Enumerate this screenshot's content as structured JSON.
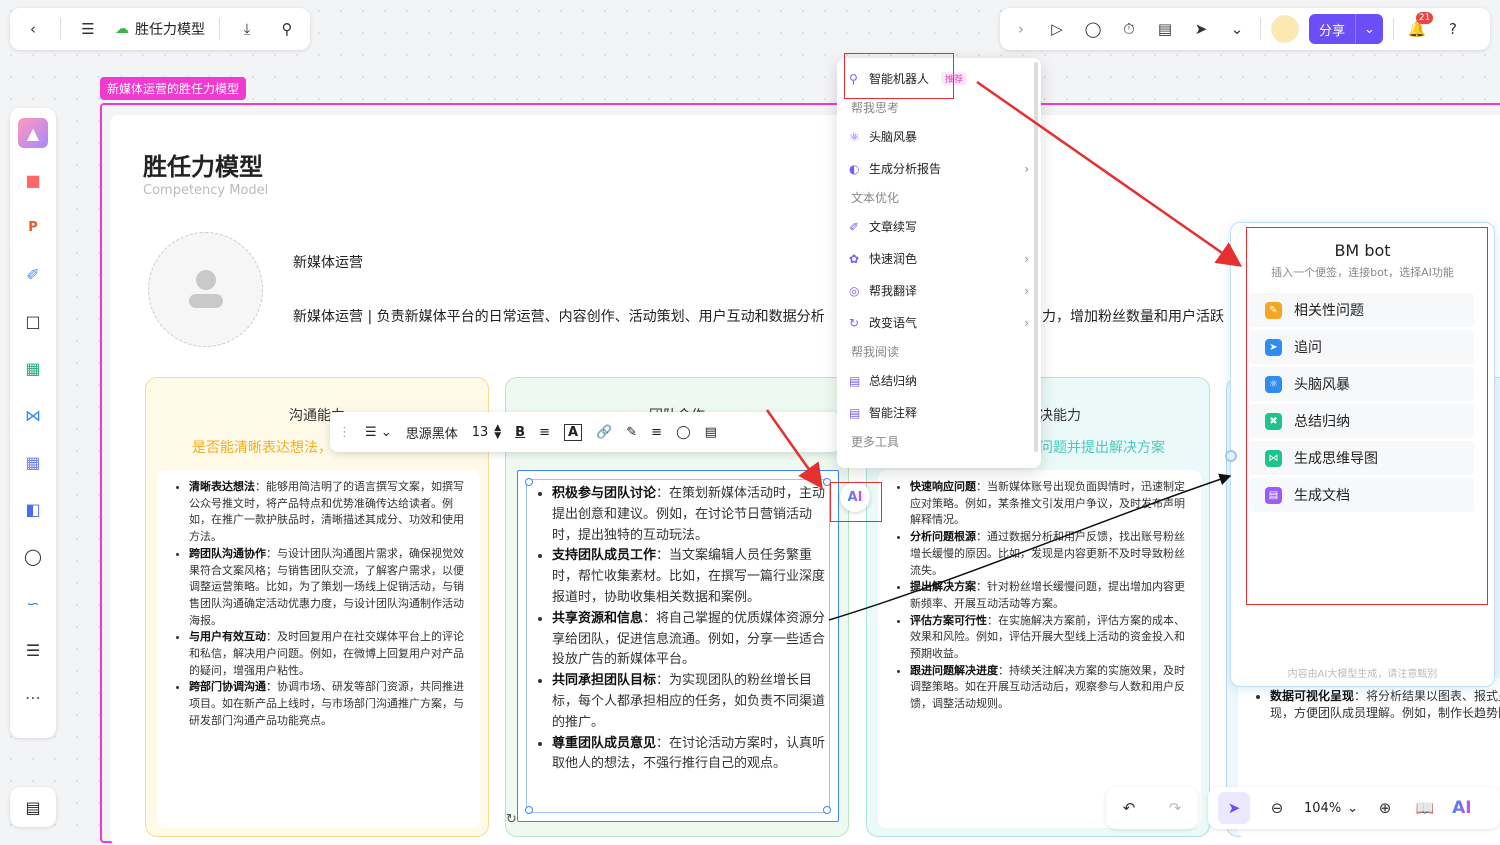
{
  "topbar": {
    "back_icon": "chevron-left-icon",
    "menu_icon": "hamburger-icon",
    "doc_title": "胜任力模型",
    "share_label": "分享",
    "notification_count": "21"
  },
  "frame": {
    "tag": "新媒体运营的胜任力模型",
    "title": "胜任力模型",
    "subtitle": "Competency Model",
    "role": "新媒体运营",
    "description_left": "新媒体运营 | 负责新媒体平台的日常运营、内容创作、活动策划、用户互动和数据分析",
    "description_right": "力，增加粉丝数量和用户活跃"
  },
  "columns": {
    "comm": {
      "heading": "沟通能力",
      "subheading": "是否能清晰表达想法，",
      "items": [
        {
          "bold": "清晰表达想法",
          "text": "：能够用简洁明了的语言撰写文案，如撰写公众号推文时，将产品特点和优势准确传达给读者。例如，在推广一款护肤品时，清晰描述其成分、功效和使用方法。"
        },
        {
          "bold": "跨团队沟通协作",
          "text": "：与设计团队沟通图片需求，确保视觉效果符合文案风格；与销售团队交流，了解客户需求，以便调整运营策略。比如，为了策划一场线上促销活动，与销售团队沟通确定活动优惠力度，与设计团队沟通制作活动海报。"
        },
        {
          "bold": "与用户有效互动",
          "text": "：及时回复用户在社交媒体平台上的评论和私信，解决用户问题。例如，在微博上回复用户对产品的疑问，增强用户粘性。"
        },
        {
          "bold": "跨部门协调沟通",
          "text": "：协调市场、研发等部门资源，共同推进项目。如在新产品上线时，与市场部门沟通推广方案，与研发部门沟通产品功能亮点。"
        }
      ]
    },
    "team": {
      "heading": "团队合作",
      "items": [
        {
          "bold": "积极参与团队讨论",
          "text": "：在策划新媒体活动时，主动提出创意和建议。例如，在讨论节日营销活动时，提出独特的互动玩法。"
        },
        {
          "bold": "支持团队成员工作",
          "text": "：当文案编辑人员任务繁重时，帮忙收集素材。比如，在撰写一篇行业深度报道时，协助收集相关数据和案例。"
        },
        {
          "bold": "共享资源和信息",
          "text": "：将自己掌握的优质媒体资源分享给团队，促进信息流通。例如，分享一些适合投放广告的新媒体平台。"
        },
        {
          "bold": "共同承担团队目标",
          "text": "：为实现团队的粉丝增长目标，每个人都承担相应的任务，如负责不同渠道的推广。"
        },
        {
          "bold": "尊重团队成员意见",
          "text": "：在讨论活动方案时，认真听取他人的想法，不强行推行自己的观点。"
        }
      ]
    },
    "solve": {
      "heading": "决能力",
      "subheading": "问题并提出解决方案",
      "items": [
        {
          "bold": "快速响应问题",
          "text": "：当新媒体账号出现负面舆情时，迅速制定应对策略。例如，某条推文引发用户争议，及时发布声明解释情况。"
        },
        {
          "bold": "分析问题根源",
          "text": "：通过数据分析和用户反馈，找出账号粉丝增长缓慢的原因。比如，发现是内容更新不及时导致粉丝流失。"
        },
        {
          "bold": "提出解决方案",
          "text": "：针对粉丝增长缓慢问题，提出增加内容更新频率、开展互动活动等方案。"
        },
        {
          "bold": "评估方案可行性",
          "text": "：在实施解决方案前，评估方案的成本、效果和风险。例如，评估开展大型线上活动的资金投入和预期收益。"
        },
        {
          "bold": "跟进问题解决进度",
          "text": "：持续关注解决方案的实施效果，及时调整策略。如在开展互动活动后，观察参与人数和用户反馈，调整活动规则。"
        }
      ]
    },
    "data": {
      "items": [
        {
          "bold": "数据可视化呈现",
          "text": "：将分析结果以图表、报式呈现，方便团队成员理解。例如，制作长趋势图。"
        }
      ]
    }
  },
  "text_toolbar": {
    "font": "思源黑体",
    "size": "13"
  },
  "menu": {
    "top_item": "智能机器人",
    "top_badge": "推荐",
    "groups": [
      {
        "label": "帮我思考",
        "items": [
          {
            "label": "头脑风暴",
            "arrow": false
          },
          {
            "label": "生成分析报告",
            "arrow": true
          }
        ]
      },
      {
        "label": "文本优化",
        "items": [
          {
            "label": "文章续写",
            "arrow": false
          },
          {
            "label": "快速润色",
            "arrow": true
          },
          {
            "label": "帮我翻译",
            "arrow": true
          },
          {
            "label": "改变语气",
            "arrow": true
          }
        ]
      },
      {
        "label": "帮我阅读",
        "items": [
          {
            "label": "总结归纳",
            "arrow": false
          },
          {
            "label": "智能注释",
            "arrow": false
          }
        ]
      },
      {
        "label": "更多工具",
        "items": []
      }
    ]
  },
  "bot": {
    "title": "BM bot",
    "subtitle": "插入一个便签，连接bot，选择AI功能",
    "items": [
      {
        "label": "相关性问题",
        "color": "#f5a623"
      },
      {
        "label": "追问",
        "color": "#2f8cf5"
      },
      {
        "label": "头脑风暴",
        "color": "#2f8cf5"
      },
      {
        "label": "总结归纳",
        "color": "#1fc48c"
      },
      {
        "label": "生成思维导图",
        "color": "#1fc48c"
      },
      {
        "label": "生成文档",
        "color": "#9b5cf6"
      }
    ],
    "footer": "内容由AI大模型生成，请注意甄别"
  },
  "zoom": {
    "level": "104%"
  },
  "colors": {
    "accent": "#6b4ef6",
    "frame": "#f03bd0",
    "arrow": "#e53030",
    "selection": "#3d86f7"
  }
}
